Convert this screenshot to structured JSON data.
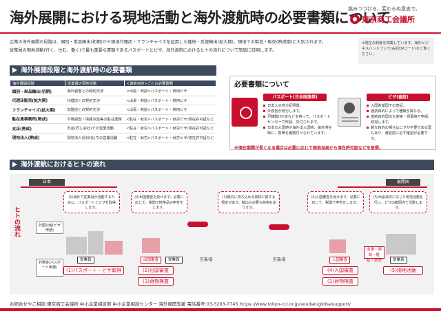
{
  "title": "海外展開における現地活動と海外渡航時の必要書類について",
  "slogan": "挑みつづける、変わらぬ意志で。",
  "logo_name": "東京商工会議所",
  "intro": [
    "企業の海外展開の段階は、個別・単品輸出(初期)から現地代理店・フランチャイズを起用した継続・反復輸出(拡大期)、現地での製造・販売(熟成期)に大別されます。",
    "従業員の現地活動(行く、住む、働く)で最も重要な書類であるパスポートとビザ、海外渡航におけるヒトの流れについて簡単に説明します。"
  ],
  "note": "※現在の制度を掲載しています。海外ビジネスハンドブック(右記QRコード)をご覧ください。",
  "section1": "海外展開段階と海外渡航時の必要書類",
  "table": {
    "headers": [
      "海外展開段階",
      "従業員の現地活動",
      "<渡航目的>ごとの必要書類"
    ],
    "rows": [
      [
        "個別・単品輸出(初期)",
        "海外顧客との契約交渉",
        "<出張・商談>パスポート・商用ビザ"
      ],
      [
        "代理店販売(拡大期)",
        "代理店との契約交渉",
        "<出張・商談>パスポート・商用ビザ"
      ],
      [
        "フランチャイズ(拡大期)",
        "加盟店との契約交渉",
        "<出張・商談>パスポート・商用ビザ"
      ],
      [
        "駐在員事務所(熟成)",
        "市場調査・情報収集等の駐在業務",
        "<駐在・就労>パスポート・就労ビザ/滞在許可証など"
      ],
      [
        "支店(熟成)",
        "支店(同じ会社)での営業活動",
        "<駐在・就労>パスポート・就労ビザ/滞在許可証など"
      ],
      [
        "現地法人(熟成)",
        "現地法人(別会社)での営業活動",
        "<駐在・就労>パスポート・就労ビザ/滞在許可証など"
      ]
    ]
  },
  "docs": {
    "title": "必要書類について",
    "passport_tag": "パスポート(日本国旅券)",
    "visa_tag": "ビザ(査証)",
    "passport_points": [
      "日本人の身分証明書。",
      "外務省が発行します。",
      "戸籍謄(抄)本などを持って、パスポートセンターで申請、交付されます。",
      "日本の入国時や海外出入国時、海外滞在時に、携帯を義務付けられています。"
    ],
    "visa_points": [
      "入国希望国での査証。",
      "渡航目的によって種類が異なる。",
      "渡航目的国の大使館・領事館で申請、取得します。",
      "観光目的の場合はビザが不要である国もあり、渡航前に必ず確認が必要です。"
    ],
    "warning": "※滞在期間が長くなる場合は必要に応じて現地当局から滞在許可証などを取得。"
  },
  "section2": "海外渡航におけるヒトの流れ",
  "flow": {
    "japan": "日本",
    "destination": "展開国",
    "side_label": "ヒトの流れ",
    "bubbles": [
      "(1)海外で従業員が活動するために、パスポートとビザを取得します。",
      "(2)出国審査を受けます。必要に応じて、税関で携帯品の申告をします。",
      "(3)機内に持ち込める荷物に関する規定があり、輸出が必要な荷物もあります。",
      "(4)入国審査を受けます。必要に応じて、税関で申告をします。",
      "(5)出張目的に応じた現地活動を行い、ビザの範囲内で活動します。"
    ],
    "office_label": "外国公館(ビザ申請)",
    "passport_center": "外務省(パスポート申請)",
    "employee1": "従業員",
    "customs_out": "出国審査",
    "employee2": "従業員",
    "airport_jp": "空港/港",
    "airport_dest": "空港/港",
    "immigration_in": "入国審査",
    "employee3": "従業員",
    "local_box": "出張・商談・駐在・就労",
    "steps": [
      "(1)パスポート・ビザ取得",
      "(2)出国審査",
      "(3)荷物検査",
      "(4)入国審査",
      "(3)荷物検査",
      "(5)現地活動"
    ]
  },
  "footer": "お問合せやご相談:東京商工会議所 中小企業相談部 中小企業相談センター 海外展開支援 電話番号:03-3283-7745 https://www.tokyo-cci.or.jp/soudan/globalsupport/"
}
